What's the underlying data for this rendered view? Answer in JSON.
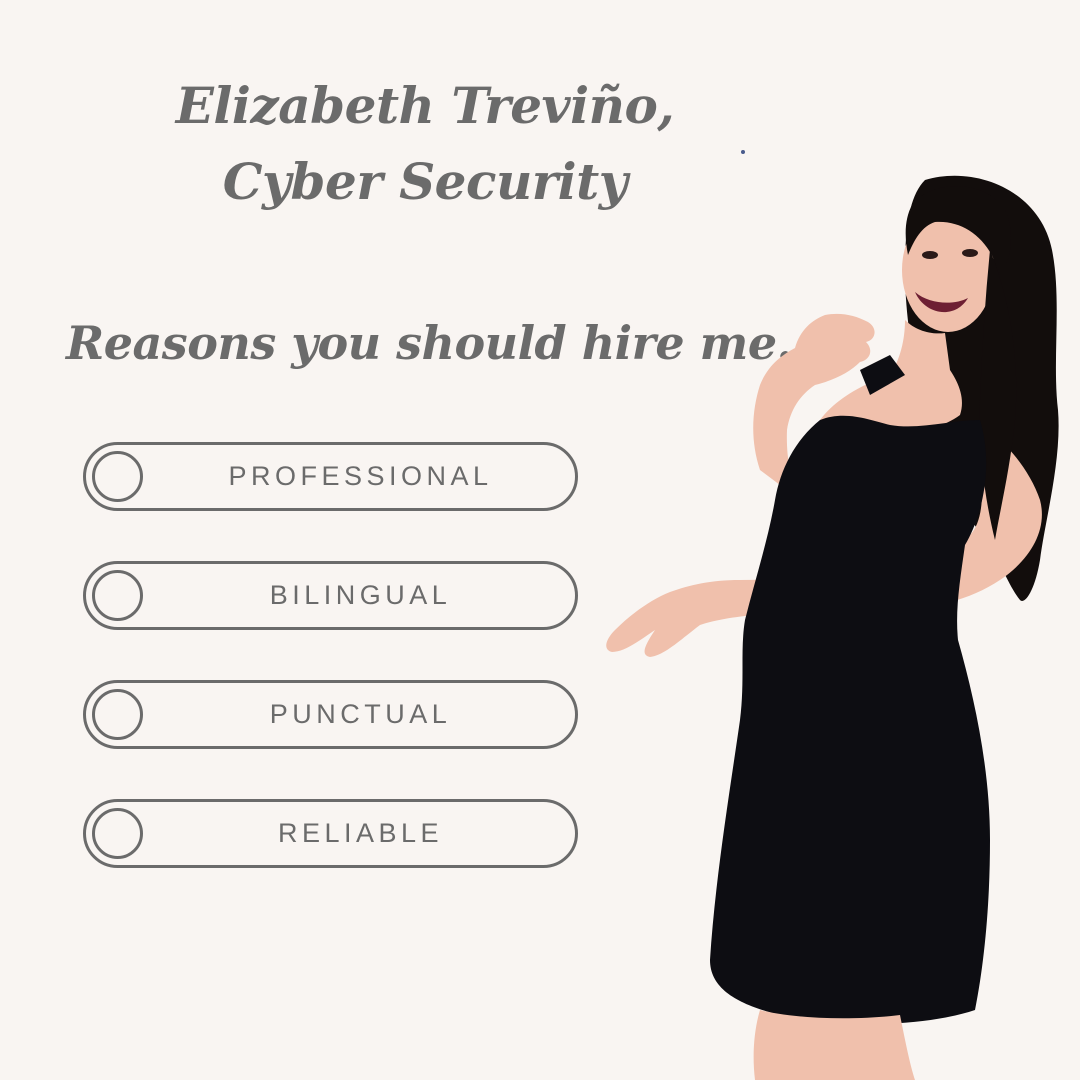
{
  "header": {
    "line1": "Elizabeth Treviño,",
    "line2": "Cyber Security"
  },
  "subtitle": "Reasons you should hire me..",
  "reasons": [
    {
      "label": "PROFESSIONAL"
    },
    {
      "label": "BILINGUAL"
    },
    {
      "label": "PUNCTUAL"
    },
    {
      "label": "RELIABLE"
    }
  ],
  "colors": {
    "background": "#f9f5f2",
    "text": "#6b6b6b",
    "dress": "#0d0d12",
    "hair": "#120d0c",
    "skin": "#f0c0ac"
  },
  "photo": {
    "subject": "woman in black dress waving with both hands, long dark hair, open smile"
  }
}
